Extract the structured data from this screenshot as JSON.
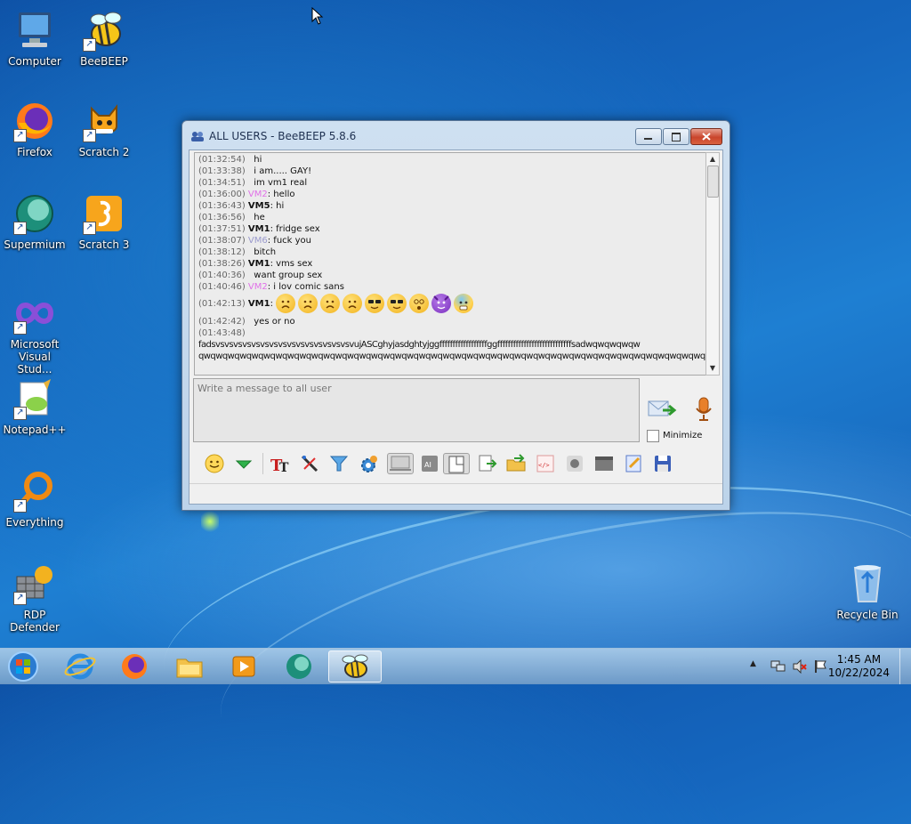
{
  "desktop": {
    "icons": [
      {
        "label": "Computer"
      },
      {
        "label": "BeeBEEP"
      },
      {
        "label": "Firefox"
      },
      {
        "label": "Scratch 2"
      },
      {
        "label": "Supermium"
      },
      {
        "label": "Scratch 3"
      },
      {
        "label_line1": "Microsoft",
        "label_line2": "Visual Stud..."
      },
      {
        "label": "Notepad++"
      },
      {
        "label": "Everything"
      },
      {
        "label": "RDP Defender"
      },
      {
        "label": "Recycle Bin"
      }
    ],
    "shortcut_arrow": "↗"
  },
  "window": {
    "title": "ALL USERS - BeeBEEP 5.8.6",
    "messages": [
      {
        "time": "(01:32:54)",
        "text": "hi"
      },
      {
        "time": "(01:33:38)",
        "text": "i am..... GAY!"
      },
      {
        "time": "(01:34:51)",
        "text": "im vm1 real"
      },
      {
        "time": "(01:36:00)",
        "user": "VM2",
        "text": ": hello"
      },
      {
        "time": "(01:36:43)",
        "user": "VM5",
        "text": ": hi"
      },
      {
        "time": "(01:36:56)",
        "text": "he"
      },
      {
        "time": "(01:37:51)",
        "user": "VM1",
        "text": ": fridge sex"
      },
      {
        "time": "(01:38:07)",
        "user": "VM6",
        "text": ": fuck you"
      },
      {
        "time": "(01:38:12)",
        "text": "bitch"
      },
      {
        "time": "(01:38:26)",
        "user": "VM1",
        "text": ": vms sex"
      },
      {
        "time": "(01:40:36)",
        "text": "want group sex"
      },
      {
        "time": "(01:40:46)",
        "user": "VM2",
        "text": ": i lov comic sans"
      },
      {
        "time": "(01:42:13)",
        "user": "VM1",
        "text": ":"
      },
      {
        "time": "(01:42:42)",
        "text": "yes or no"
      },
      {
        "time": "(01:43:48)",
        "text": ""
      },
      {
        "text": "fadsvsvsvsvsvsvsvsvsvsvsvsvsvsvsvsvujASCghyjasdghtyjggffffffffffffffffffggffffffffffffffffffffffffffffsadwqwqwqwqw"
      },
      {
        "text": "qwqwqwqwqwqwqwqwqwqwqwqwqwqwqwqwqwqwqwqwqwqwqwqwqwqwqwqwqwqwqwqwqwqwqwqwqwqwqwqwqwqwqwq"
      }
    ],
    "emojis": [
      "sad-face",
      "sad-face",
      "sad-face",
      "sad-face",
      "sunglasses-face",
      "sunglasses-face",
      "dizzy-face",
      "devil-face",
      "anxious-face"
    ],
    "input_placeholder": "Write a message to all user",
    "minimize_label": "Minimize",
    "minimize_checked": false,
    "toolbar_icons": [
      "smile-icon",
      "green-arrow-icon",
      "font-icon",
      "color-pen-icon",
      "filter-icon",
      "gear-icon",
      "monitor-icon",
      "ai-icon",
      "window-icon",
      "export-icon",
      "folder-share-icon",
      "code-icon",
      "record-icon",
      "screenshot-icon",
      "notes-icon",
      "save-icon"
    ],
    "colors": {
      "vm2": "#e070e8",
      "vm6": "#9a9acd"
    }
  },
  "taskbar": {
    "items": [
      "start-button",
      "internet-explorer-icon",
      "firefox-icon",
      "file-explorer-icon",
      "media-player-icon",
      "supermium-icon",
      "beebeep-icon"
    ],
    "time": "1:45 AM",
    "date": "10/22/2024"
  }
}
